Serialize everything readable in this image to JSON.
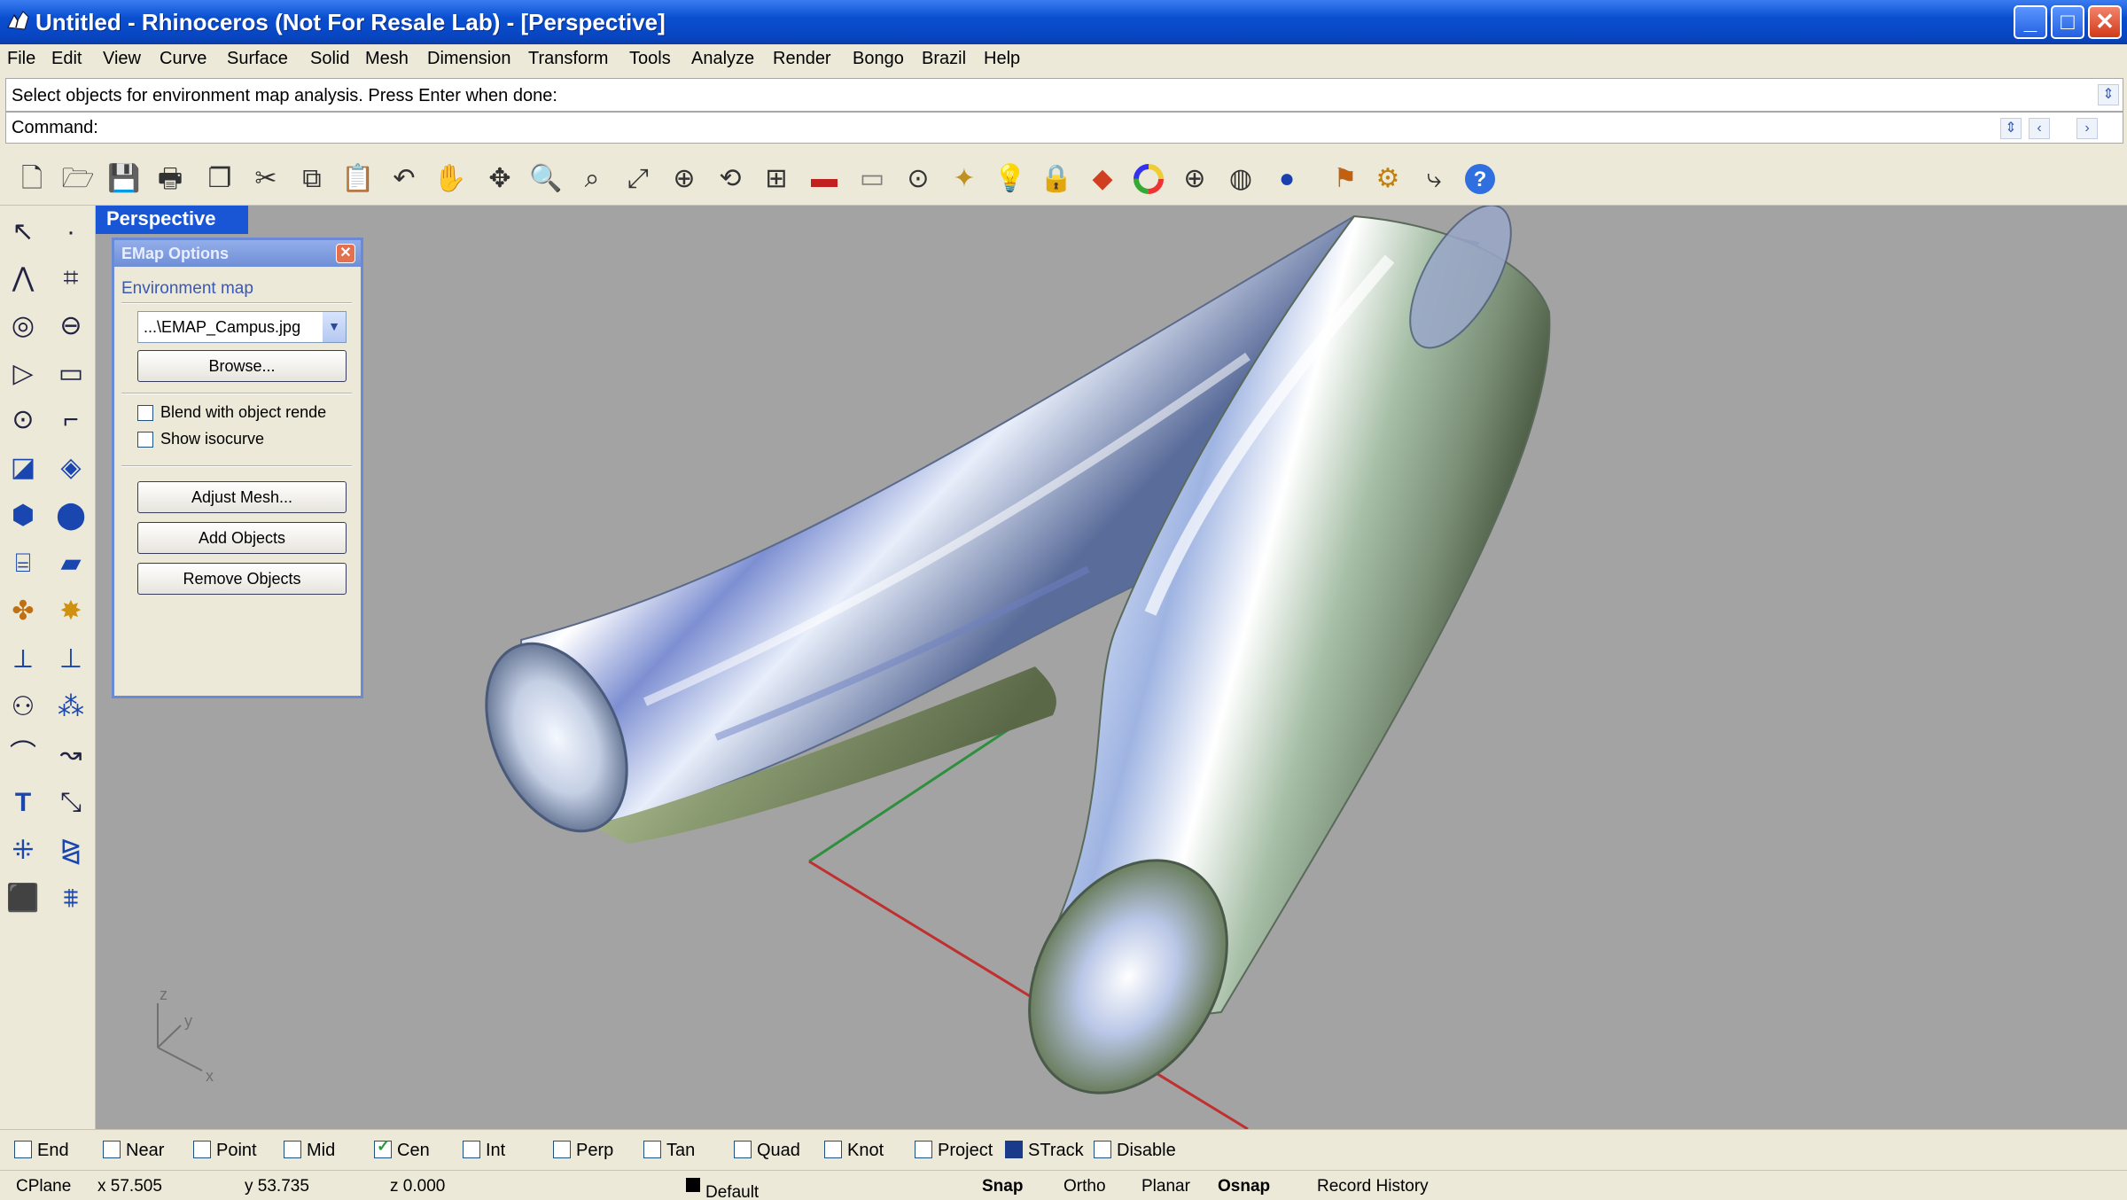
{
  "window": {
    "title": "Untitled - Rhinoceros (Not For Resale Lab) - [Perspective]",
    "controls": {
      "minimize": "_",
      "maximize": "□",
      "close": "✕"
    }
  },
  "menu": [
    "File",
    "Edit",
    "View",
    "Curve",
    "Surface",
    "Solid",
    "Mesh",
    "Dimension",
    "Transform",
    "Tools",
    "Analyze",
    "Render",
    "Bongo",
    "Brazil",
    "Help"
  ],
  "command": {
    "prompt": "Select objects for environment map analysis. Press Enter when done:",
    "label": "Command:"
  },
  "viewport": {
    "name": "Perspective",
    "axes": {
      "x": "x",
      "y": "y",
      "z": "z"
    }
  },
  "emap_panel": {
    "title": "EMap Options",
    "close": "✕",
    "group_label": "Environment map",
    "file": "...\\EMAP_Campus.jpg",
    "browse": "Browse...",
    "blend_label": "Blend with object rende",
    "blend_checked": false,
    "isocurve_label": "Show isocurve",
    "isocurve_checked": false,
    "adjust_mesh": "Adjust Mesh...",
    "add_objects": "Add Objects",
    "remove_objects": "Remove Objects"
  },
  "osnap": [
    {
      "label": "End",
      "checked": false
    },
    {
      "label": "Near",
      "checked": false
    },
    {
      "label": "Point",
      "checked": false
    },
    {
      "label": "Mid",
      "checked": false
    },
    {
      "label": "Cen",
      "checked": true
    },
    {
      "label": "Int",
      "checked": false
    },
    {
      "label": "Perp",
      "checked": false
    },
    {
      "label": "Tan",
      "checked": false
    },
    {
      "label": "Quad",
      "checked": false
    },
    {
      "label": "Knot",
      "checked": false
    },
    {
      "label": "Project",
      "checked": false
    },
    {
      "label": "STrack",
      "checked": true
    },
    {
      "label": "Disable",
      "checked": false
    }
  ],
  "status": {
    "cplane": "CPlane",
    "x": "x 57.505",
    "y": "y 53.735",
    "z": "z 0.000",
    "layer": "Default",
    "snap": "Snap",
    "ortho": "Ortho",
    "planar": "Planar",
    "osnap": "Osnap",
    "record_history": "Record History"
  },
  "colors": {
    "viewport_bg": "#a3a3a3",
    "title_bar": "#0a4fd0",
    "viewport_tab": "#1956d6",
    "x_axis": "#c03030",
    "y_axis": "#2f8f3f"
  }
}
